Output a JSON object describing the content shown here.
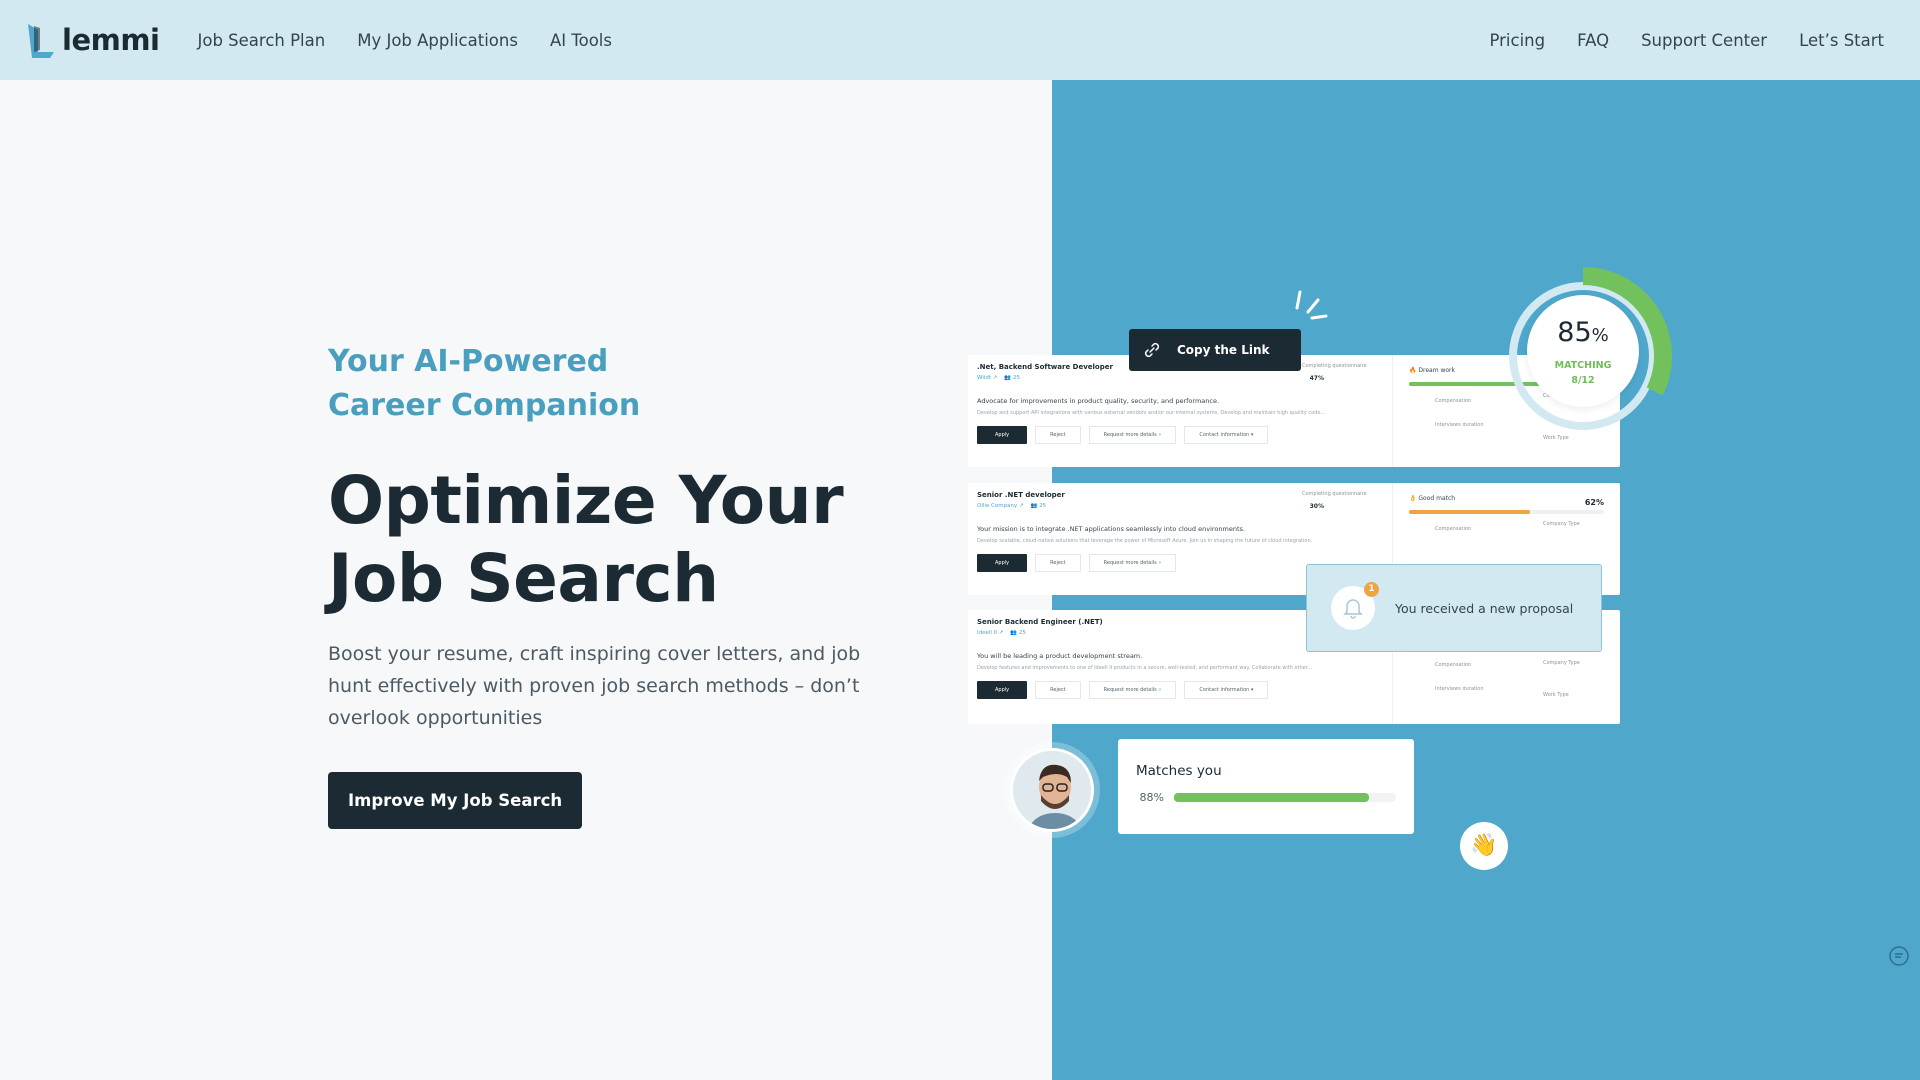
{
  "nav": {
    "logo": "lemmi",
    "left": [
      "Job Search Plan",
      "My Job Applications",
      "AI Tools"
    ],
    "right": [
      "Pricing",
      "FAQ",
      "Support Center",
      "Let’s Start"
    ]
  },
  "hero": {
    "eyebrow": "Your AI-Powered Career Companion",
    "headline": "Optimize Your Job Search",
    "sub": "Boost your resume, craft inspiring cover letters, and job hunt effectively with proven job search methods – don’t overlook opportunities",
    "cta": "Improve My Job Search"
  },
  "tooltip": "Copy the Link",
  "ring": {
    "value": "85",
    "unit": "%",
    "label": "MATCHING",
    "count": "8/12",
    "progress": 0.85
  },
  "jobs": [
    {
      "title": ".Net, Backend Software Developer",
      "company": "Wiidt",
      "candidates": "25",
      "desc": "Advocate for improvements in product quality, security, and performance.",
      "desc2": "Develop and support API integrations with various external vendors and/or our internal systems. Develop and maintain high quality code...",
      "label": "Completing questionnaire",
      "pct": "47%",
      "match": "Dream work",
      "match_pct": "",
      "bar_color": "#72c15d",
      "bar": 0.83,
      "apply": "Apply",
      "reject": "Reject",
      "more": "Request more details",
      "contact": "Contact information",
      "f1": "Compensation",
      "f2": "Company Type",
      "f3": "Interviews duration",
      "f4": "Work Type"
    },
    {
      "title": "Senior .NET developer",
      "company": "Ollie Company",
      "candidates": "25",
      "desc": "Your mission is to integrate .NET applications seamlessly into cloud environments.",
      "desc2": "Develop scalable, cloud-native solutions that leverage the power of Microsoft Azure. Join us in shaping the future of cloud integration.",
      "label": "Completing questionnaire",
      "pct": "30%",
      "match": "Good match",
      "match_pct": "62%",
      "bar_color": "#f0a341",
      "bar": 0.62,
      "apply": "Apply",
      "reject": "Reject",
      "more": "Request more details",
      "contact": "",
      "f1": "Compensation",
      "f2": "Company Type",
      "f3": "",
      "f4": ""
    },
    {
      "title": "Senior Backend Engineer (.NET)",
      "company": "Ideell II",
      "candidates": "25",
      "desc": "You will be leading a product development stream.",
      "desc2": "Develop features and improvements to one of Ideell II products in a secure, well-tested, and performant way. Collaborate with other...",
      "label": "",
      "pct": "",
      "match": "",
      "match_pct": "",
      "bar_color": "#72c15d",
      "bar": 0,
      "apply": "Apply",
      "reject": "Reject",
      "more": "Request more details",
      "contact": "Contact information",
      "f1": "Compensation",
      "f2": "Company Type",
      "f3": "Interviews duration",
      "f4": "Work Type"
    }
  ],
  "notification": {
    "count": "1",
    "text": "You received a new proposal"
  },
  "matches": {
    "title": "Matches you",
    "pct": "88%",
    "value": 0.88
  }
}
